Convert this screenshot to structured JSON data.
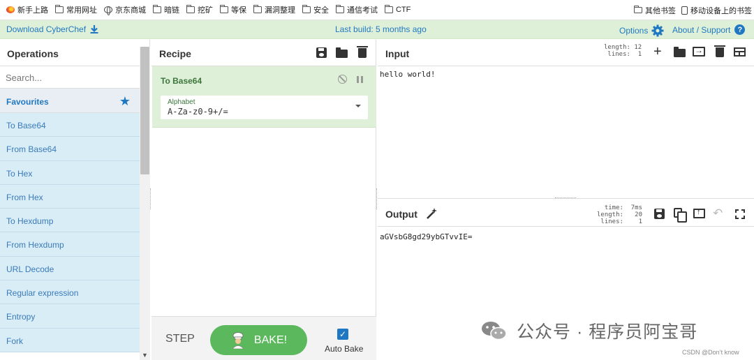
{
  "bookmarks": {
    "left": [
      {
        "icon": "firefox-icon",
        "label": "新手上路"
      },
      {
        "icon": "folder-icon",
        "label": "常用网址"
      },
      {
        "icon": "globe-icon",
        "label": "京东商城"
      },
      {
        "icon": "folder-icon",
        "label": "暗链"
      },
      {
        "icon": "folder-icon",
        "label": "挖矿"
      },
      {
        "icon": "folder-icon",
        "label": "等保"
      },
      {
        "icon": "folder-icon",
        "label": "漏洞整理"
      },
      {
        "icon": "folder-icon",
        "label": "安全"
      },
      {
        "icon": "folder-icon",
        "label": "通信考试"
      },
      {
        "icon": "folder-icon",
        "label": "CTF"
      }
    ],
    "other": "其他书签",
    "mobile": "移动设备上的书签"
  },
  "banner": {
    "download": "Download CyberChef",
    "last_build": "Last build: 5 months ago",
    "options": "Options",
    "about": "About / Support",
    "about_badge": "?"
  },
  "operations": {
    "title": "Operations",
    "search_placeholder": "Search...",
    "favourites": "Favourites",
    "items": [
      "To Base64",
      "From Base64",
      "To Hex",
      "From Hex",
      "To Hexdump",
      "From Hexdump",
      "URL Decode",
      "Regular expression",
      "Entropy",
      "Fork"
    ]
  },
  "recipe": {
    "title": "Recipe",
    "operation": {
      "name": "To Base64",
      "arg_label": "Alphabet",
      "arg_value": "A-Za-z0-9+/="
    },
    "step": "STEP",
    "bake": "BAKE!",
    "auto_bake": "Auto Bake",
    "auto_bake_checked": true
  },
  "input": {
    "title": "Input",
    "stats": "length: 12\n lines:  1",
    "text": "hello world!"
  },
  "output": {
    "title": "Output",
    "stats": "  time:  7ms\nlength:   20\n lines:    1",
    "text": "aGVsbG8gd29ybGTvvIE="
  },
  "watermark": {
    "text": "公众号 · 程序员阿宝哥",
    "credit": "CSDN @Don’t know"
  },
  "colors": {
    "banner_bg": "#dff0d8",
    "accent": "#1f78c1",
    "op_item_bg": "#d9edf7",
    "bake_green": "#5cb85c"
  }
}
